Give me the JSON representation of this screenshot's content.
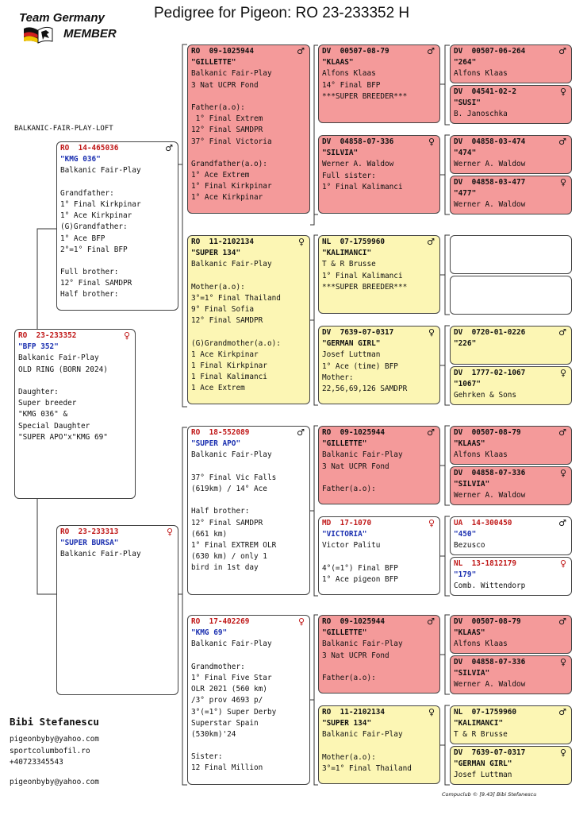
{
  "logo": {
    "line1": "Team Germany",
    "line2": "MEMBER"
  },
  "title": "Pedigree for Pigeon: RO  23-233352 H",
  "loft": "BALKANIC-FAIR-PLAY-LOFT",
  "owner": {
    "name": "Bibi Stefanescu",
    "lines": [
      "pigeonbyby@yahoo.com",
      "sportcolumbofil.ro",
      "+40723345543"
    ],
    "email": "pigeonbyby@yahoo.com"
  },
  "footer": "Compuclub © [9.43]  Bibi Stefanescu",
  "colors": {
    "red_box": "#f49a9a",
    "yellow_box": "#fcf6b4",
    "ring_red": "#c01818",
    "name_blue": "#1a2fb0"
  },
  "boxes": [
    {
      "ring": "RO  23-233352",
      "sex": "♀",
      "name": "\"BFP 352\"",
      "lines": [
        "Balkanic Fair-Play",
        "OLD RING (BORN 2024)",
        "",
        "Daughter:",
        "Super breeder",
        "\"KMG 036\" &",
        "Special Daughter",
        "\"SUPER APO\"x\"KMG 69\""
      ]
    },
    {
      "ring": "RO  14-465036",
      "sex": "♂",
      "name": "\"KMG 036\"",
      "lines": [
        "Balkanic Fair-Play",
        "",
        "Grandfather:",
        "1° Final Kirkpinar",
        "1° Ace Kirkpinar",
        "(G)Grandfather:",
        "1° Ace BFP",
        "2°=1° Final BFP",
        "",
        "Full brother:",
        "12° Final SAMDPR",
        "Half brother:"
      ]
    },
    {
      "ring": "RO  23-233313",
      "sex": "♀",
      "name": "\"SUPER BURSA\"",
      "lines": [
        "Balkanic Fair-Play"
      ]
    },
    {
      "ring": "RO  09-1025944",
      "sex": "♂",
      "name": "\"GILLETTE\"",
      "lines": [
        "Balkanic Fair-Play",
        "3 Nat UCPR Fond",
        "",
        "Father(a.o):",
        " 1° Final Extrem",
        "12° Final SAMDPR",
        "37° Final Victoria",
        "",
        "Grandfather(a.o):",
        "1° Ace Extrem",
        "1° Final Kirkpinar",
        "1° Ace Kirkpinar"
      ]
    },
    {
      "ring": "RO  11-2102134",
      "sex": "♀",
      "name": "\"SUPER 134\"",
      "lines": [
        "Balkanic Fair-Play",
        "",
        "Mother(a.o):",
        "3°=1° Final Thailand",
        "9° Final Sofia",
        "12° Final SAMDPR",
        "",
        "(G)Grandmother(a.o):",
        "1 Ace Kirkpinar",
        "1 Final Kirkpinar",
        "1 Final Kalimanci",
        "1 Ace Extrem"
      ]
    },
    {
      "ring": "RO  18-552089",
      "sex": "♂",
      "name": "\"SUPER APO\"",
      "lines": [
        "Balkanic Fair-Play",
        "",
        "37° Final Vic Falls",
        "(619km) / 14° Ace",
        "",
        "Half brother:",
        "12° Final SAMDPR",
        "(661 km)",
        "1° Final EXTREM OLR",
        "(630 km) / only 1",
        "bird in 1st day"
      ]
    },
    {
      "ring": "RO  17-402269",
      "sex": "♀",
      "name": "\"KMG 69\"",
      "lines": [
        "Balkanic Fair-Play",
        "",
        "Grandmother:",
        "1° Final Five Star",
        "OLR 2021 (560 km)",
        "/3° prov 4693 p/",
        "3°(=1°) Super Derby",
        "Superstar Spain",
        "(530km)'24",
        "",
        "Sister:",
        "12 Final Million"
      ]
    },
    {
      "ring": "DV  00507-08-79",
      "sex": "♂",
      "name": "\"KLAAS\"",
      "lines": [
        "Alfons Klaas",
        "14° Final BFP",
        "***SUPER BREEDER***"
      ]
    },
    {
      "ring": "DV  04858-07-336",
      "sex": "♀",
      "name": "\"SILVIA\"",
      "lines": [
        "Werner A. Waldow",
        "Full sister:",
        "1° Final Kalimanci"
      ]
    },
    {
      "ring": "NL  07-1759960",
      "sex": "♂",
      "name": "\"KALIMANCI\"",
      "lines": [
        "T & R Brusse",
        "1° Final Kalimanci",
        "***SUPER BREEDER***"
      ]
    },
    {
      "ring": "DV  7639-07-0317",
      "sex": "♀",
      "name": "\"GERMAN GIRL\"",
      "lines": [
        "Josef Luttman",
        "1° Ace (time) BFP",
        "Mother:",
        "22,56,69,126 SAMDPR"
      ]
    },
    {
      "ring": "RO  09-1025944",
      "sex": "♂",
      "name": "\"GILLETTE\"",
      "lines": [
        "Balkanic Fair-Play",
        "3 Nat UCPR Fond",
        "",
        "Father(a.o):"
      ]
    },
    {
      "ring": "MD  17-1070",
      "sex": "♀",
      "name": "\"VICTORIA\"",
      "lines": [
        "Victor Palitu",
        "",
        "4°(=1°) Final BFP",
        "1° Ace pigeon BFP"
      ]
    },
    {
      "ring": "RO  09-1025944",
      "sex": "♂",
      "name": "\"GILLETTE\"",
      "lines": [
        "Balkanic Fair-Play",
        "3 Nat UCPR Fond",
        "",
        "Father(a.o):"
      ]
    },
    {
      "ring": "RO  11-2102134",
      "sex": "♀",
      "name": "\"SUPER 134\"",
      "lines": [
        "Balkanic Fair-Play",
        "",
        "Mother(a.o):",
        "3°=1° Final Thailand"
      ]
    },
    {
      "ring": "DV  00507-06-264",
      "sex": "♂",
      "name": "\"264\"",
      "lines": [
        "Alfons Klaas"
      ]
    },
    {
      "ring": "DV  04541-02-2",
      "sex": "♀",
      "name": "\"SUSI\"",
      "lines": [
        "B. Janoschka"
      ]
    },
    {
      "ring": "DV  04858-03-474",
      "sex": "♂",
      "name": "\"474\"",
      "lines": [
        "Werner A. Waldow"
      ]
    },
    {
      "ring": "DV  04858-03-477",
      "sex": "♀",
      "name": "\"477\"",
      "lines": [
        "Werner A. Waldow"
      ]
    },
    {
      "ring": "",
      "sex": "",
      "name": "",
      "lines": []
    },
    {
      "ring": "",
      "sex": "",
      "name": "",
      "lines": []
    },
    {
      "ring": "DV  0720-01-0226",
      "sex": "♂",
      "name": "\"226\"",
      "lines": []
    },
    {
      "ring": "DV  1777-02-1067",
      "sex": "♀",
      "name": "\"1067\"",
      "lines": [
        "Gehrken & Sons"
      ]
    },
    {
      "ring": "DV  00507-08-79",
      "sex": "♂",
      "name": "\"KLAAS\"",
      "lines": [
        "Alfons Klaas"
      ]
    },
    {
      "ring": "DV  04858-07-336",
      "sex": "♀",
      "name": "\"SILVIA\"",
      "lines": [
        "Werner A. Waldow"
      ]
    },
    {
      "ring": "UA  14-300450",
      "sex": "♂",
      "name": "\"450\"",
      "lines": [
        "Bezusco"
      ]
    },
    {
      "ring": "NL  13-1812179",
      "sex": "♀",
      "name": "\"179\"",
      "lines": [
        "Comb. Wittendorp"
      ]
    },
    {
      "ring": "DV  00507-08-79",
      "sex": "♂",
      "name": "\"KLAAS\"",
      "lines": [
        "Alfons Klaas"
      ]
    },
    {
      "ring": "DV  04858-07-336",
      "sex": "♀",
      "name": "\"SILVIA\"",
      "lines": [
        "Werner A. Waldow"
      ]
    },
    {
      "ring": "NL  07-1759960",
      "sex": "♂",
      "name": "\"KALIMANCI\"",
      "lines": [
        "T & R Brusse"
      ]
    },
    {
      "ring": "DV  7639-07-0317",
      "sex": "♀",
      "name": "\"GERMAN GIRL\"",
      "lines": [
        "Josef Luttman"
      ]
    }
  ]
}
